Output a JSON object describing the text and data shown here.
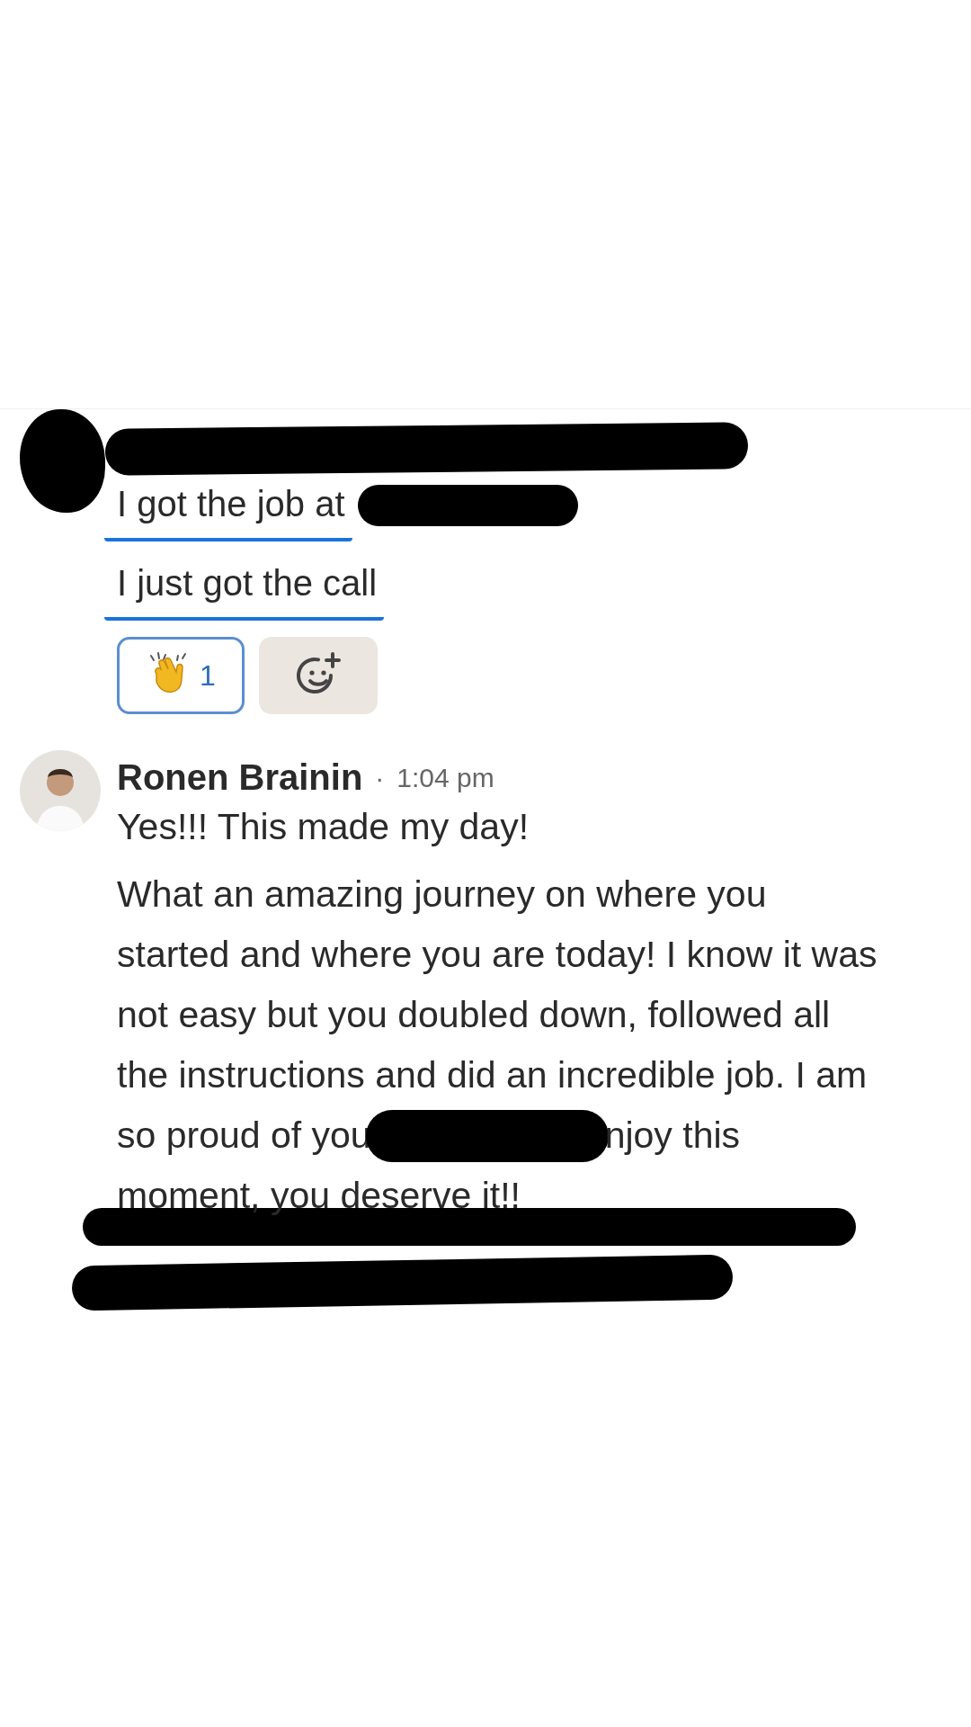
{
  "first_message": {
    "avatar_redacted": true,
    "name_redacted": true,
    "lines": [
      {
        "text": "I got the job at",
        "underlined": true,
        "redacted_tail": true
      },
      {
        "text": "I just got the call",
        "underlined": true,
        "redacted_tail": false
      }
    ],
    "reactions": [
      {
        "kind": "emoji",
        "count": "1",
        "selected": true
      },
      {
        "kind": "add",
        "selected": false
      }
    ]
  },
  "reply": {
    "name": "Ronen Brainin",
    "separator": "·",
    "time": "1:04 pm",
    "paragraphs": [
      [
        [
          {
            "kind": "text",
            "text": "Yes!!! This made my day!"
          }
        ]
      ],
      [
        [
          {
            "kind": "text",
            "text": "What an amazing journey on where you"
          }
        ],
        [
          {
            "kind": "text",
            "text": "started and where you are today! I know it was"
          }
        ],
        [
          {
            "kind": "text",
            "text": "not easy but you doubled down, followed all"
          }
        ],
        [
          {
            "kind": "text",
            "text": "the instructions and did an incredible job. I am"
          }
        ],
        [
          {
            "kind": "text",
            "text": "so proud of you"
          },
          {
            "kind": "redaction"
          },
          {
            "kind": "text",
            "text": "njoy this"
          }
        ],
        [
          {
            "kind": "text",
            "text": "moment, you deserve it!!"
          }
        ]
      ]
    ]
  },
  "bottom_redactions": [
    {
      "kind": "redaction"
    },
    {
      "kind": "redaction"
    }
  ]
}
